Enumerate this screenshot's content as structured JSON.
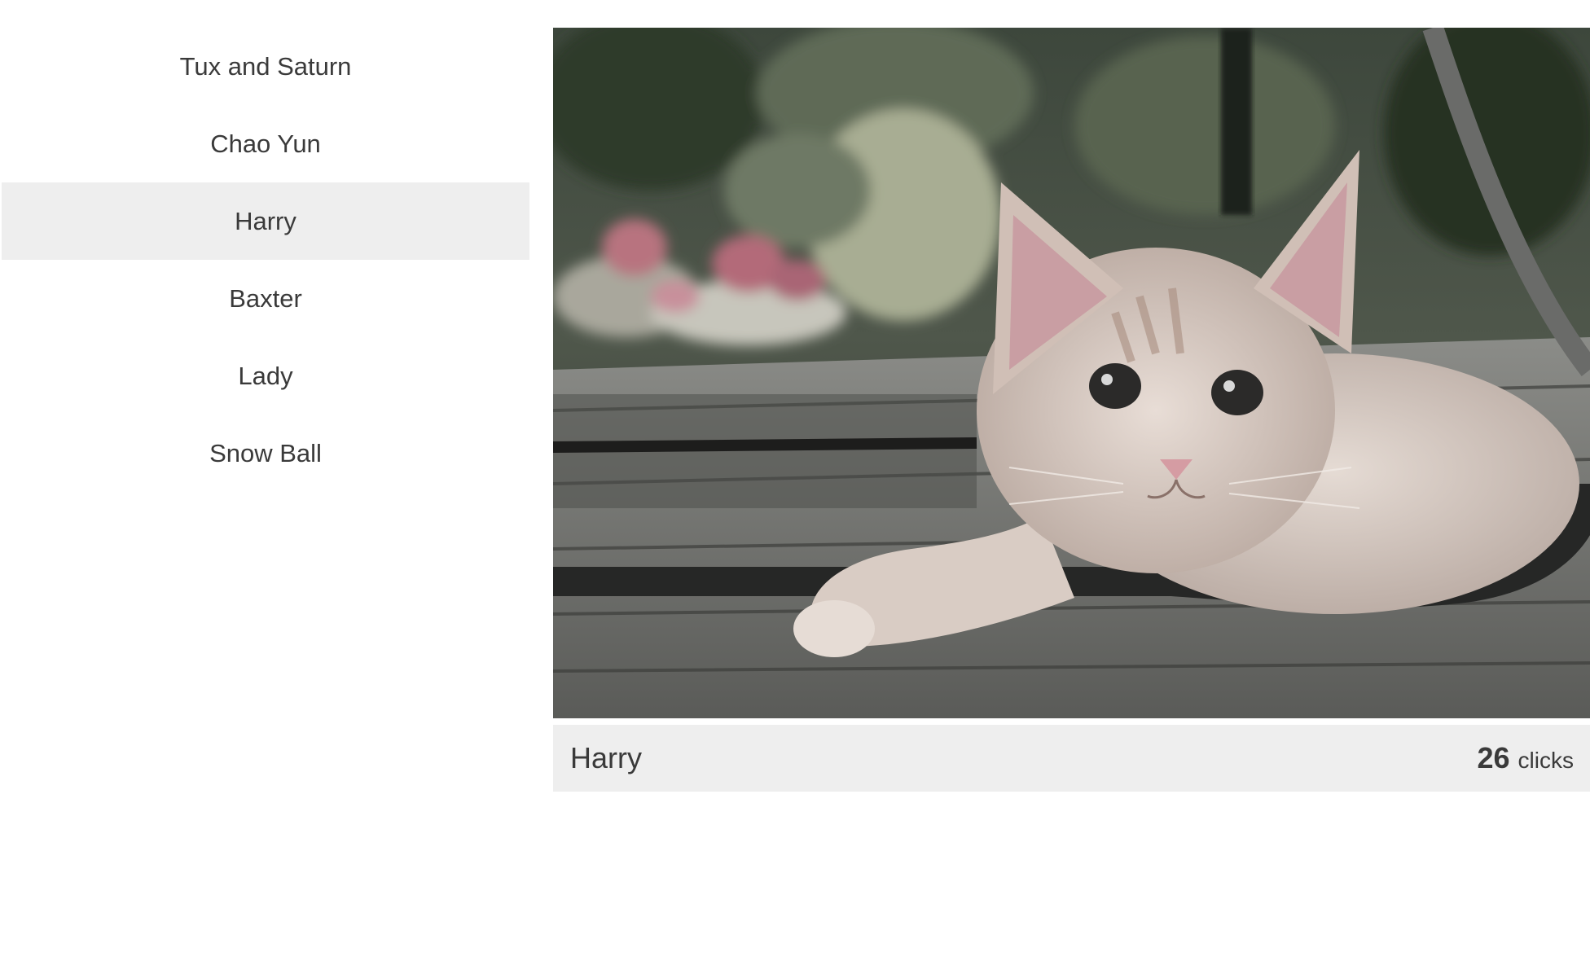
{
  "cats": [
    {
      "name": "Tux and Saturn",
      "active": false
    },
    {
      "name": "Chao Yun",
      "active": false
    },
    {
      "name": "Harry",
      "active": true
    },
    {
      "name": "Baxter",
      "active": false
    },
    {
      "name": "Lady",
      "active": false
    },
    {
      "name": "Snow Ball",
      "active": false
    }
  ],
  "viewer": {
    "name": "Harry",
    "count": "26",
    "count_unit": "clicks",
    "photo_subject": "kitten-photo"
  },
  "colors": {
    "active_bg": "#eeeeee",
    "caption_bg": "#eeeeee",
    "text": "#3a3a3a"
  }
}
